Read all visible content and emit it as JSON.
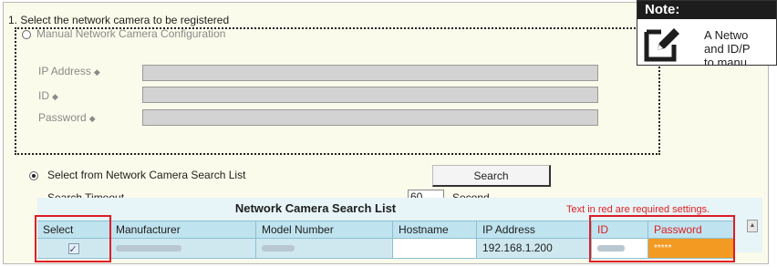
{
  "step": {
    "title": "1. Select the network camera to be registered"
  },
  "manual": {
    "label": "Manual Network Camera Configuration",
    "fields": [
      {
        "label": "IP Address",
        "mark": "◆"
      },
      {
        "label": "ID",
        "mark": "◆"
      },
      {
        "label": "Password",
        "mark": "◆"
      }
    ]
  },
  "search": {
    "option_label": "Select from Network Camera Search List",
    "button_label": "Search",
    "timeout_label": "Search Timeout",
    "timeout_value": "60",
    "timeout_unit": "Second"
  },
  "table": {
    "title": "Network Camera Search List",
    "required_note": "Text in red are required settings.",
    "columns": [
      "Select",
      "Manufacturer",
      "Model Number",
      "Hostname",
      "IP Address",
      "ID",
      "Password"
    ],
    "row": {
      "selected": true,
      "manufacturer": "",
      "model_number": "",
      "hostname": "",
      "ip_address": "192.168.1.200",
      "id": "",
      "password": "*****"
    }
  },
  "note": {
    "heading": "Note:",
    "line1": "A Netwo",
    "line2": "and ID/P",
    "line3": "to manu"
  },
  "colors": {
    "panel_bg": "#fbfbeb",
    "table_header_bg": "#bfe3ef",
    "required_text": "#e02020",
    "highlight_border": "#e01b24",
    "password_bg": "#f39a22"
  }
}
